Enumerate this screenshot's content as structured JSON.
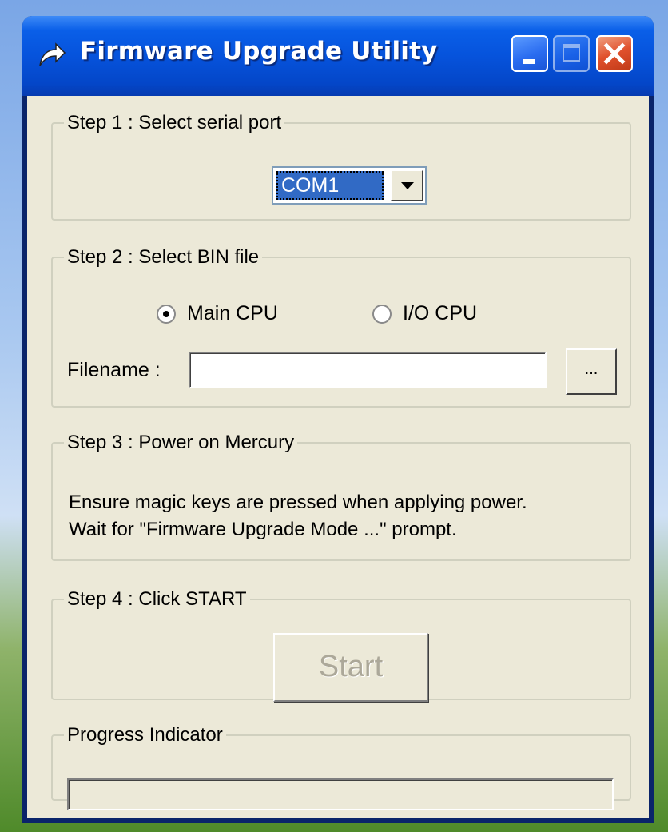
{
  "window": {
    "title": "Firmware Upgrade Utility",
    "icon": "arrow-icon",
    "controls": {
      "minimize": "minimize-icon",
      "maximize": "maximize-icon",
      "close": "close-icon"
    }
  },
  "step1": {
    "legend": "Step 1 : Select serial port",
    "port_value": "COM1"
  },
  "step2": {
    "legend": "Step 2 : Select BIN file",
    "radio_main": "Main CPU",
    "radio_io": "I/O CPU",
    "selected": "Main CPU",
    "filename_label": "Filename :",
    "filename_value": "",
    "browse_label": "..."
  },
  "step3": {
    "legend": "Step 3 : Power on Mercury",
    "line1": "Ensure magic keys are pressed when applying power.",
    "line2": "Wait for \"Firmware Upgrade Mode ...\" prompt."
  },
  "step4": {
    "legend": "Step 4 : Click START",
    "start_label": "Start",
    "start_enabled": false
  },
  "progress": {
    "legend": "Progress Indicator",
    "value": 0
  },
  "colors": {
    "titlebar": "#0653dc",
    "close": "#e0502c",
    "face": "#ece9d8",
    "selection": "#316ac5"
  }
}
